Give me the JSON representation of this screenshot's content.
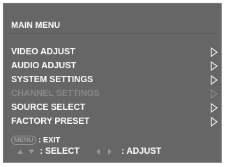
{
  "title": "MAIN MENU",
  "menu": {
    "items": [
      {
        "label": "VIDEO ADJUST",
        "enabled": true
      },
      {
        "label": "AUDIO ADJUST",
        "enabled": true
      },
      {
        "label": "SYSTEM SETTINGS",
        "enabled": true
      },
      {
        "label": "CHANNEL SETTINGS",
        "enabled": false
      },
      {
        "label": "SOURCE SELECT",
        "enabled": true
      },
      {
        "label": "FACTORY PRESET",
        "enabled": true
      }
    ]
  },
  "footer": {
    "menu_key": "MENU",
    "exit_label": ": EXIT",
    "select_label": ": SELECT",
    "adjust_label": ": ADJUST"
  },
  "colors": {
    "panel": "#666666",
    "text": "#ffffff",
    "disabled": "#898989",
    "hint": "#999999"
  },
  "icons": {
    "submenu": "triangle-right-outline-icon",
    "up_down": "up-down-arrows-icon",
    "left_right": "left-right-arrows-icon"
  }
}
